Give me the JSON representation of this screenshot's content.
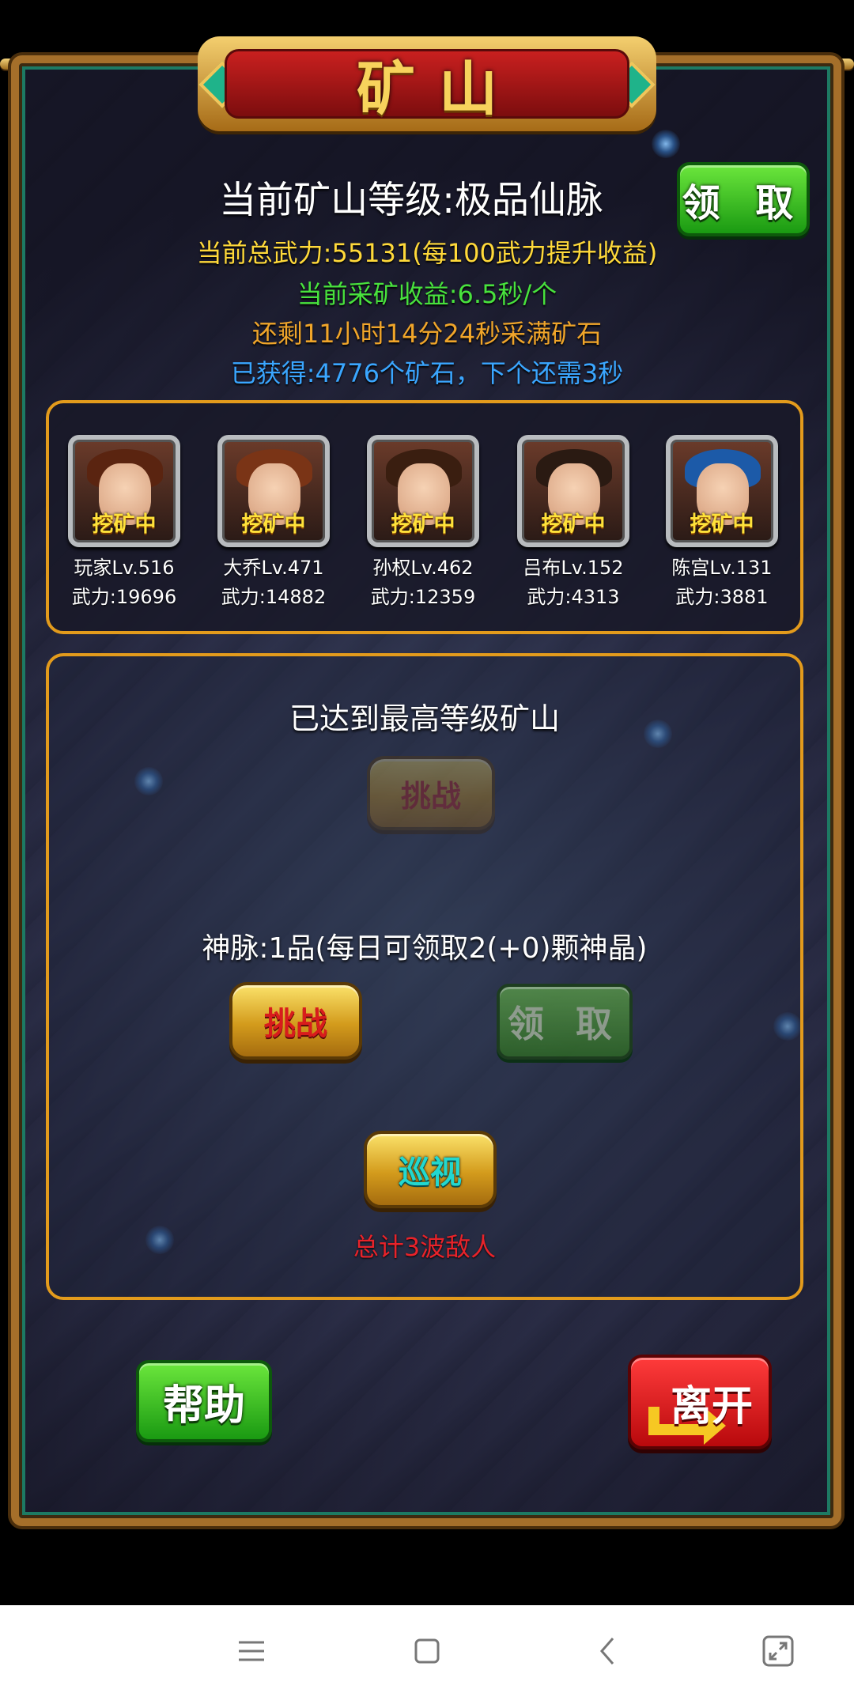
{
  "header": {
    "title": "矿山"
  },
  "mine_info": {
    "level_line": "当前矿山等级:极品仙脉",
    "power_line": "当前总武力:55131(每100武力提升收益)",
    "income_line": "当前采矿收益:6.5秒/个",
    "remaining_line": "还剩11小时14分24秒采满矿石",
    "obtained_line": "已获得:4776个矿石，下个还需3秒",
    "claim_label": "领 取"
  },
  "heroes": [
    {
      "name": "玩家Lv.516",
      "power": "武力:19696",
      "status": "挖矿中",
      "hair_color": "#5a2410"
    },
    {
      "name": "大乔Lv.471",
      "power": "武力:14882",
      "status": "挖矿中",
      "hair_color": "#7a3416"
    },
    {
      "name": "孙权Lv.462",
      "power": "武力:12359",
      "status": "挖矿中",
      "hair_color": "#3a1e10"
    },
    {
      "name": "吕布Lv.152",
      "power": "武力:4313",
      "status": "挖矿中",
      "hair_color": "#2a1a12"
    },
    {
      "name": "陈宫Lv.131",
      "power": "武力:3881",
      "status": "挖矿中",
      "hair_color": "#1c5aa8"
    }
  ],
  "mine_panel": {
    "max_level_text": "已达到最高等级矿山",
    "challenge_disabled_label": "挑战",
    "vein_text": "神脉:1品(每日可领取2(+0)颗神晶)",
    "challenge_label": "挑战",
    "claim_disabled_label": "领 取",
    "patrol_label": "巡视",
    "enemy_text": "总计3波敌人"
  },
  "footer": {
    "help_label": "帮助",
    "leave_label": "离开"
  },
  "colors": {
    "gold_border": "#e39b1c",
    "info_yellow": "#ffd93a",
    "info_green": "#48e23d",
    "info_orange": "#f0a52a",
    "info_blue": "#3aa6ff"
  },
  "navbar": {
    "icons": [
      "menu-icon",
      "home-icon",
      "back-icon",
      "rotate-icon"
    ]
  }
}
